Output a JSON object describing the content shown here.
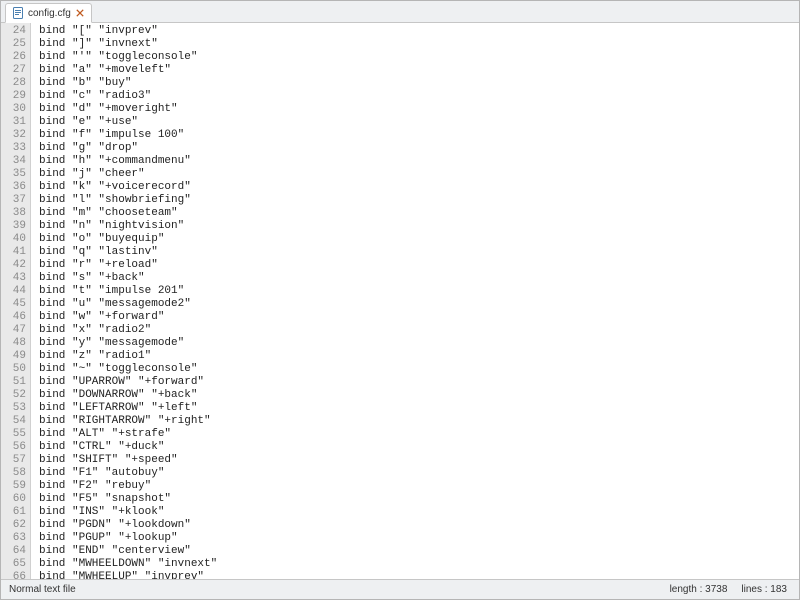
{
  "tab": {
    "filename": "config.cfg",
    "icon": "file-icon",
    "close": "close-icon"
  },
  "first_line_number": 24,
  "code_lines": [
    "bind \"[\" \"invprev\"",
    "bind \"]\" \"invnext\"",
    "bind \"'\" \"toggleconsole\"",
    "bind \"a\" \"+moveleft\"",
    "bind \"b\" \"buy\"",
    "bind \"c\" \"radio3\"",
    "bind \"d\" \"+moveright\"",
    "bind \"e\" \"+use\"",
    "bind \"f\" \"impulse 100\"",
    "bind \"g\" \"drop\"",
    "bind \"h\" \"+commandmenu\"",
    "bind \"j\" \"cheer\"",
    "bind \"k\" \"+voicerecord\"",
    "bind \"l\" \"showbriefing\"",
    "bind \"m\" \"chooseteam\"",
    "bind \"n\" \"nightvision\"",
    "bind \"o\" \"buyequip\"",
    "bind \"q\" \"lastinv\"",
    "bind \"r\" \"+reload\"",
    "bind \"s\" \"+back\"",
    "bind \"t\" \"impulse 201\"",
    "bind \"u\" \"messagemode2\"",
    "bind \"w\" \"+forward\"",
    "bind \"x\" \"radio2\"",
    "bind \"y\" \"messagemode\"",
    "bind \"z\" \"radio1\"",
    "bind \"~\" \"toggleconsole\"",
    "bind \"UPARROW\" \"+forward\"",
    "bind \"DOWNARROW\" \"+back\"",
    "bind \"LEFTARROW\" \"+left\"",
    "bind \"RIGHTARROW\" \"+right\"",
    "bind \"ALT\" \"+strafe\"",
    "bind \"CTRL\" \"+duck\"",
    "bind \"SHIFT\" \"+speed\"",
    "bind \"F1\" \"autobuy\"",
    "bind \"F2\" \"rebuy\"",
    "bind \"F5\" \"snapshot\"",
    "bind \"INS\" \"+klook\"",
    "bind \"PGDN\" \"+lookdown\"",
    "bind \"PGUP\" \"+lookup\"",
    "bind \"END\" \"centerview\"",
    "bind \"MWHEELDOWN\" \"invnext\"",
    "bind \"MWHEELUP\" \"invprev\""
  ],
  "status": {
    "filetype": "Normal text file",
    "length_label": "length : 3738",
    "lines_label": "lines : 183"
  }
}
